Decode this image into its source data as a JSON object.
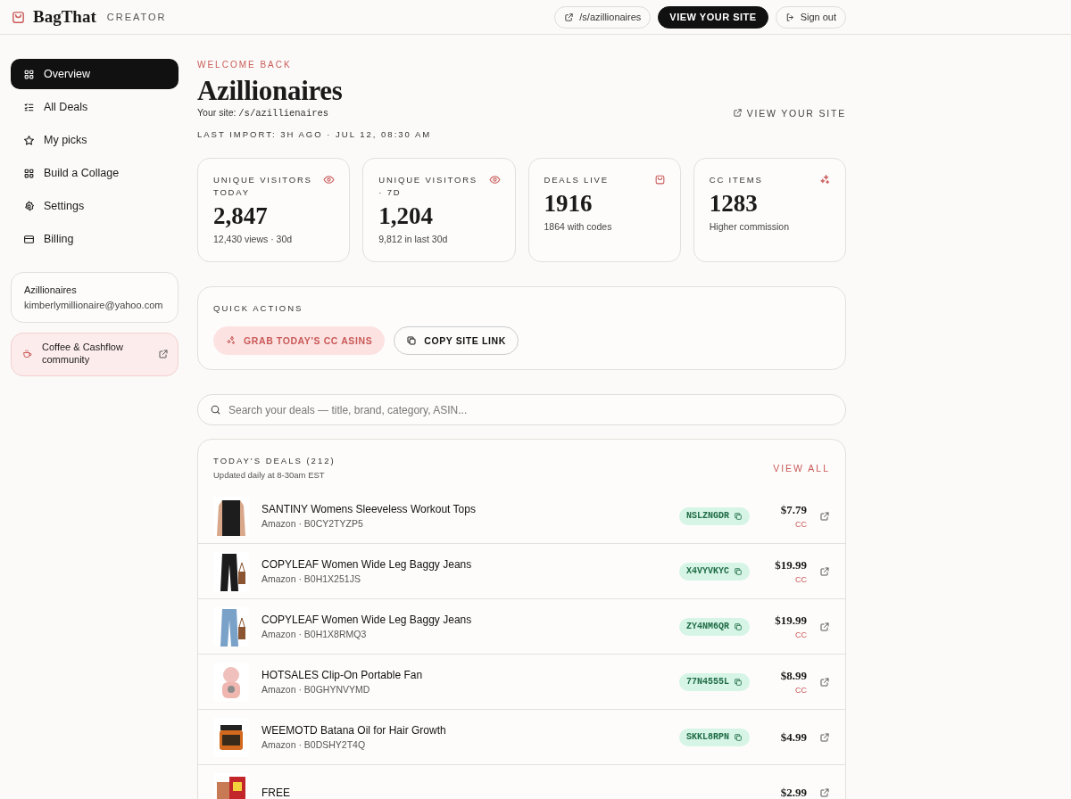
{
  "header": {
    "brand": "BagThat",
    "tagline": "CREATOR",
    "site_link": "/s/azillionaires",
    "view_site": "VIEW YOUR SITE",
    "sign_out": "Sign out"
  },
  "sidebar": {
    "items": [
      {
        "label": "Overview",
        "selected": true
      },
      {
        "label": "All Deals",
        "selected": false
      },
      {
        "label": "My picks",
        "selected": false
      },
      {
        "label": "Build a Collage",
        "selected": false
      },
      {
        "label": "Settings",
        "selected": false
      },
      {
        "label": "Billing",
        "selected": false
      }
    ],
    "account": {
      "name": "Azillionaires",
      "email": "kimberlymillionaire@yahoo.com"
    },
    "community": {
      "label": "Coffee & Cashflow community"
    }
  },
  "welcome": {
    "eyebrow": "WELCOME BACK",
    "title": "Azillionaires",
    "site_label": "Your site:",
    "site_path": "/s/azillienaires",
    "view_site": "VIEW YOUR SITE",
    "last_import": "LAST IMPORT: 3H AGO · JUL 12, 08:30 AM"
  },
  "stats": [
    {
      "label": "UNIQUE VISITORS TODAY",
      "value": "2,847",
      "note": "12,430 views · 30d"
    },
    {
      "label": "UNIQUE VISITORS · 7D",
      "value": "1,204",
      "note": "9,812 in last 30d"
    },
    {
      "label": "DEALS LIVE",
      "value": "1916",
      "note": "1864 with codes"
    },
    {
      "label": "CC ITEMS",
      "value": "1283",
      "note": "Higher commission"
    }
  ],
  "quick_actions": {
    "title": "QUICK ACTIONS",
    "buttons": [
      {
        "label": "GRAB TODAY'S CC ASINS",
        "kind": "primary"
      },
      {
        "label": "COPY SITE LINK",
        "kind": "outline"
      }
    ]
  },
  "search": {
    "placeholder": "Search your deals — title, brand, category, ASIN..."
  },
  "deals": {
    "title": "TODAY'S DEALS (212)",
    "subtitle": "Updated daily at 8-30am EST",
    "view_all": "VIEW ALL",
    "rows": [
      {
        "title": "SANTINY Womens Sleeveless Workout Tops",
        "meta": "Amazon · B0CY2TYZP5",
        "code": "NSLZNGDR",
        "price": "$7.79",
        "tag": "CC"
      },
      {
        "title": "COPYLEAF Women Wide Leg Baggy Jeans",
        "meta": "Amazon · B0H1X251JS",
        "code": "X4VYVKYC",
        "price": "$19.99",
        "tag": "CC"
      },
      {
        "title": "COPYLEAF Women Wide Leg Baggy Jeans",
        "meta": "Amazon · B0H1X8RMQ3",
        "code": "ZY4NM6QR",
        "price": "$19.99",
        "tag": "CC"
      },
      {
        "title": "HOTSALES Clip-On Portable Fan",
        "meta": "Amazon · B0GHYNVYMD",
        "code": "77N4555L",
        "price": "$8.99",
        "tag": "CC"
      },
      {
        "title": "WEEMOTD Batana Oil for Hair Growth",
        "meta": "Amazon · B0DSHY2T4Q",
        "code": "SKKL8RPN",
        "price": "$4.99"
      },
      {
        "title": "FREE",
        "price": "$2.99"
      }
    ]
  }
}
